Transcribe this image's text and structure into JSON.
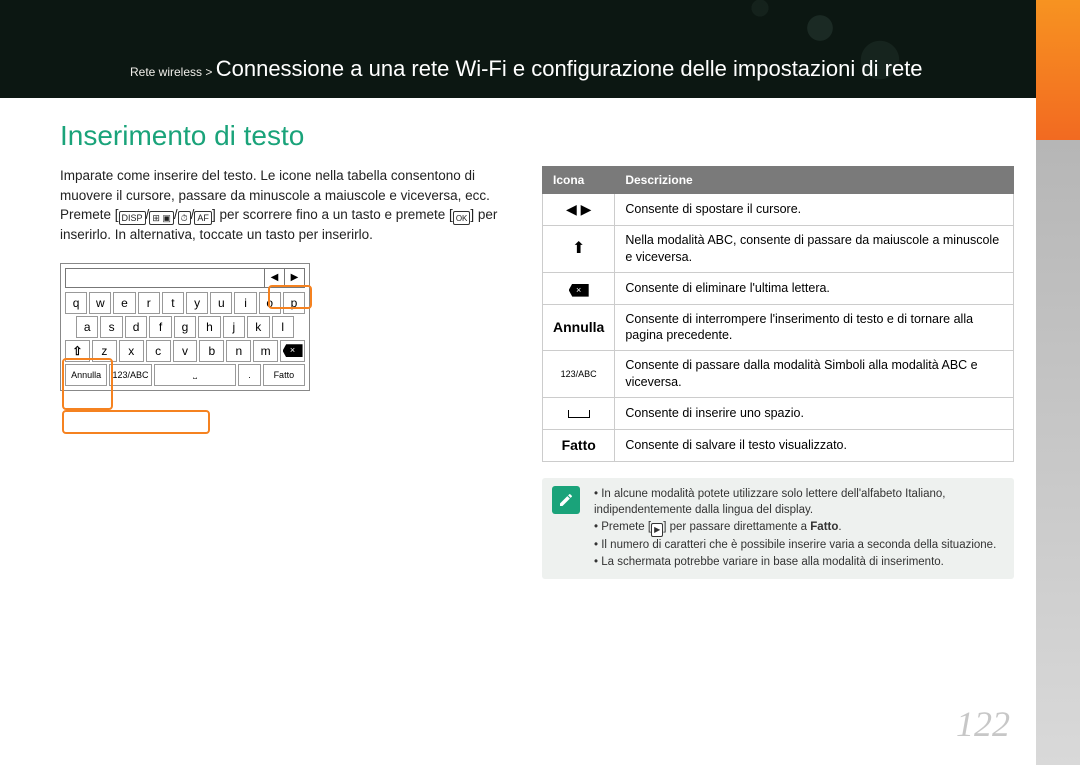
{
  "breadcrumb": {
    "section": "Rete wireless >",
    "title": "Connessione a una rete Wi-Fi e configurazione delle impostazioni di rete"
  },
  "heading": "Inserimento di testo",
  "intro": "Imparate come inserire del testo. Le icone nella tabella consentono di muovere il cursore, passare da minuscole a maiuscole e viceversa, ecc.",
  "press1": "Premete [",
  "press_disp": "DISP",
  "press_af": "AF",
  "press2": "] per scorrere fino a un tasto e premete [",
  "press_ok": "OK",
  "press3": "] per inserirlo. In alternativa, toccate un tasto per inserirlo.",
  "kb": {
    "row1": [
      "q",
      "w",
      "e",
      "r",
      "t",
      "y",
      "u",
      "i",
      "o",
      "p"
    ],
    "row2": [
      "a",
      "s",
      "d",
      "f",
      "g",
      "h",
      "j",
      "k",
      "l"
    ],
    "row3": [
      "⇧",
      "z",
      "x",
      "c",
      "v",
      "b",
      "n",
      "m",
      "⌫"
    ],
    "footer": {
      "cancel": "Annulla",
      "mode": "123/ABC",
      "space": "⎵",
      "dot": ".",
      "done": "Fatto"
    },
    "nav": {
      "left": "◀",
      "right": "▶"
    }
  },
  "table": {
    "h1": "Icona",
    "h2": "Descrizione",
    "rows": [
      {
        "icon": "◀ ▶",
        "desc": "Consente di spostare il cursore."
      },
      {
        "icon": "⇧",
        "desc": "Nella modalità ABC, consente di passare da maiuscole a minuscole e viceversa."
      },
      {
        "icon": "DEL",
        "desc": "Consente di eliminare l'ultima lettera."
      },
      {
        "icon": "Annulla",
        "bold": true,
        "desc": "Consente di interrompere l'inserimento di testo e di tornare alla pagina precedente."
      },
      {
        "icon": "123/ABC",
        "small": true,
        "desc": "Consente di passare dalla modalità Simboli alla modalità ABC e viceversa."
      },
      {
        "icon": "⎵",
        "desc": "Consente di inserire uno spazio."
      },
      {
        "icon": "Fatto",
        "bold": true,
        "desc": "Consente di salvare il testo visualizzato."
      }
    ]
  },
  "notes": {
    "items": [
      "In alcune modalità potete utilizzare solo lettere dell'alfabeto Italiano, indipendentemente dalla lingua del display.",
      "Premete [▶] per passare direttamente a Fatto.",
      "Il numero di caratteri che è possibile inserire varia a seconda della situazione.",
      "La schermata potrebbe variare in base alla modalità di inserimento."
    ],
    "fatto": "Fatto"
  },
  "page": "122"
}
